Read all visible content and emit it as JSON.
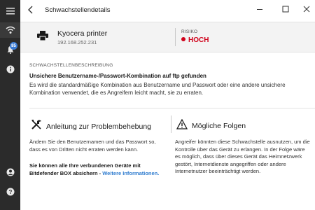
{
  "sidebar": {
    "notification_count": "85"
  },
  "header": {
    "back_icon": "back-arrow-icon",
    "title": "Schwachstellendetails"
  },
  "device": {
    "name": "Kyocera printer",
    "ip": "192.168.252.231",
    "risk_label": "RISIKO",
    "risk_value": "HOCH",
    "risk_color": "#d0021b"
  },
  "description": {
    "section_label": "SCHWACHSTELLENBESCHREIBUNG",
    "title": "Unsichere Benutzername-/Passwort-Kombination auf ftp gefunden",
    "text": "Es wird die standardmäßige Kombination aus Benutzername und Passwort oder eine andere unsichere Kombination verwendet, die es Angreifern leicht macht, sie zu erraten."
  },
  "remediation": {
    "heading": "Anleitung zur Problembehebung",
    "text": "Ändern Sie den Benutzernamen und das Passwort so, dass es von Dritten nicht erraten werden kann.",
    "protect_text": "Sie können alle Ihre verbundenen Geräte mit Bitdefender BOX absichern -",
    "link_text": "Weitere Informationen."
  },
  "consequences": {
    "heading": "Mögliche Folgen",
    "text": "Angreifer könnten diese Schwachstelle ausnutzen, um die Kontrolle über das Gerät zu erlangen. In der Folge wäre es möglich, dass über dieses Gerät das Heimnetzwerk gestört, Internetdienste angegriffen oder andere Internetnutzer beeinträchtigt werden."
  }
}
